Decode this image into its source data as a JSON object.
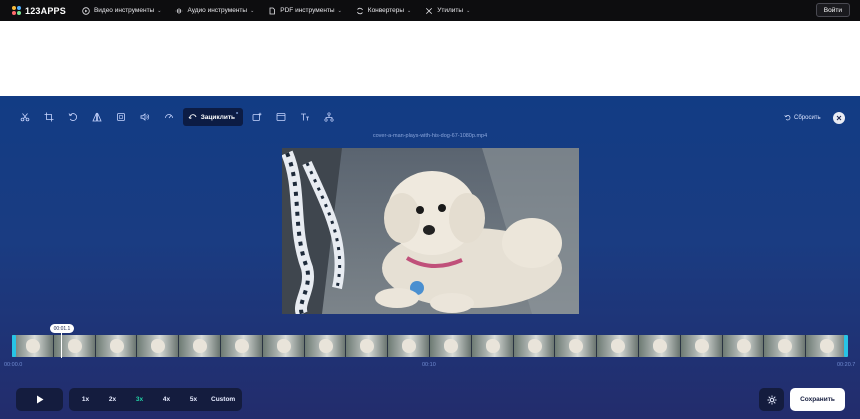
{
  "header": {
    "logo_text": "123APPS",
    "nav": [
      {
        "label": "Видео инструменты",
        "icon": "play-circle-icon"
      },
      {
        "label": "Аудио инструменты",
        "icon": "waveform-icon"
      },
      {
        "label": "PDF инструменты",
        "icon": "pdf-icon"
      },
      {
        "label": "Конвертеры",
        "icon": "convert-icon"
      },
      {
        "label": "Утилиты",
        "icon": "tools-icon"
      }
    ],
    "login_label": "Войти"
  },
  "editor": {
    "toolbar": {
      "tools": [
        "cut-icon",
        "crop-icon",
        "rotate-icon",
        "flip-icon",
        "resize-icon",
        "volume-icon",
        "speed-icon",
        "loop-icon",
        "add-image-icon",
        "frame-icon",
        "text-icon",
        "merge-icon"
      ],
      "active_label": "Зациклить",
      "active_badge": "x"
    },
    "reset_label": "Сбросить",
    "filename": "cover-a-man-plays-with-his-dog-67-1080p.mp4",
    "timeline": {
      "current_time": "00:01.1",
      "start_time": "00:00.0",
      "mid_time": "00:10",
      "end_time": "00:20.7"
    },
    "speeds": [
      "1x",
      "2x",
      "3x",
      "4x",
      "5x",
      "Custom"
    ],
    "selected_speed": "3x",
    "save_label": "Сохранить"
  },
  "colors": {
    "accent": "#22d3a6",
    "handle": "#27c4e6",
    "panel_top": "#123c84",
    "panel_bottom": "#232c6c"
  }
}
